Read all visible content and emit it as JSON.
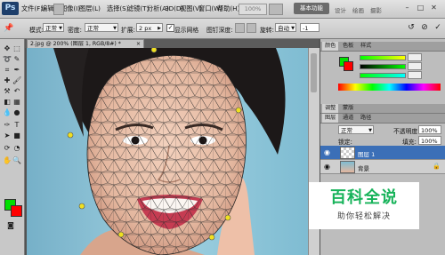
{
  "app": {
    "logo_text": "Ps",
    "zoom_readout": "100%",
    "workspace_button": "基本功能",
    "workspace_links": [
      "设计",
      "绘画",
      "摄影"
    ]
  },
  "menu": {
    "items": [
      "文件(F)",
      "编辑(E)",
      "图像(I)",
      "图层(L)",
      "选择(S)",
      "滤镜(T)",
      "分析(A)",
      "3D(D)",
      "视图(V)",
      "窗口(W)",
      "帮助(H)"
    ]
  },
  "options": {
    "mode_label": "模式:",
    "mode_value": "正常",
    "density_label": "密度:",
    "density_value": "正常",
    "expand_label": "扩展:",
    "expand_value": "2 px",
    "show_mesh_label": "显示网格",
    "pin_depth_label": "图钉深度:",
    "rotate_label": "旋转:",
    "rotate_value": "自动",
    "rotate_degrees": "-1"
  },
  "document": {
    "tab_title": "2.jpg @ 200% (图层 1, RGB/8#) *"
  },
  "panels": {
    "color_tabs": [
      "颜色",
      "色板",
      "样式"
    ],
    "color_values": [
      "",
      "",
      ""
    ],
    "adjust_tabs": [
      "调整",
      "蒙版"
    ],
    "layers_tabs": [
      "图层",
      "通道",
      "路径"
    ],
    "blend_mode": "正常",
    "opacity_label": "不透明度:",
    "opacity_value": "100%",
    "lock_label": "锁定:",
    "fill_label": "填充:",
    "fill_value": "100%",
    "layers": [
      {
        "name": "图层 1"
      },
      {
        "name": "背景"
      }
    ]
  },
  "watermark": {
    "title": "百科全说",
    "subtitle": "助你轻松解决"
  },
  "colors": {
    "foreground": "#00e000",
    "background": "#ff0000",
    "accent_blue": "#3b6fb7"
  }
}
